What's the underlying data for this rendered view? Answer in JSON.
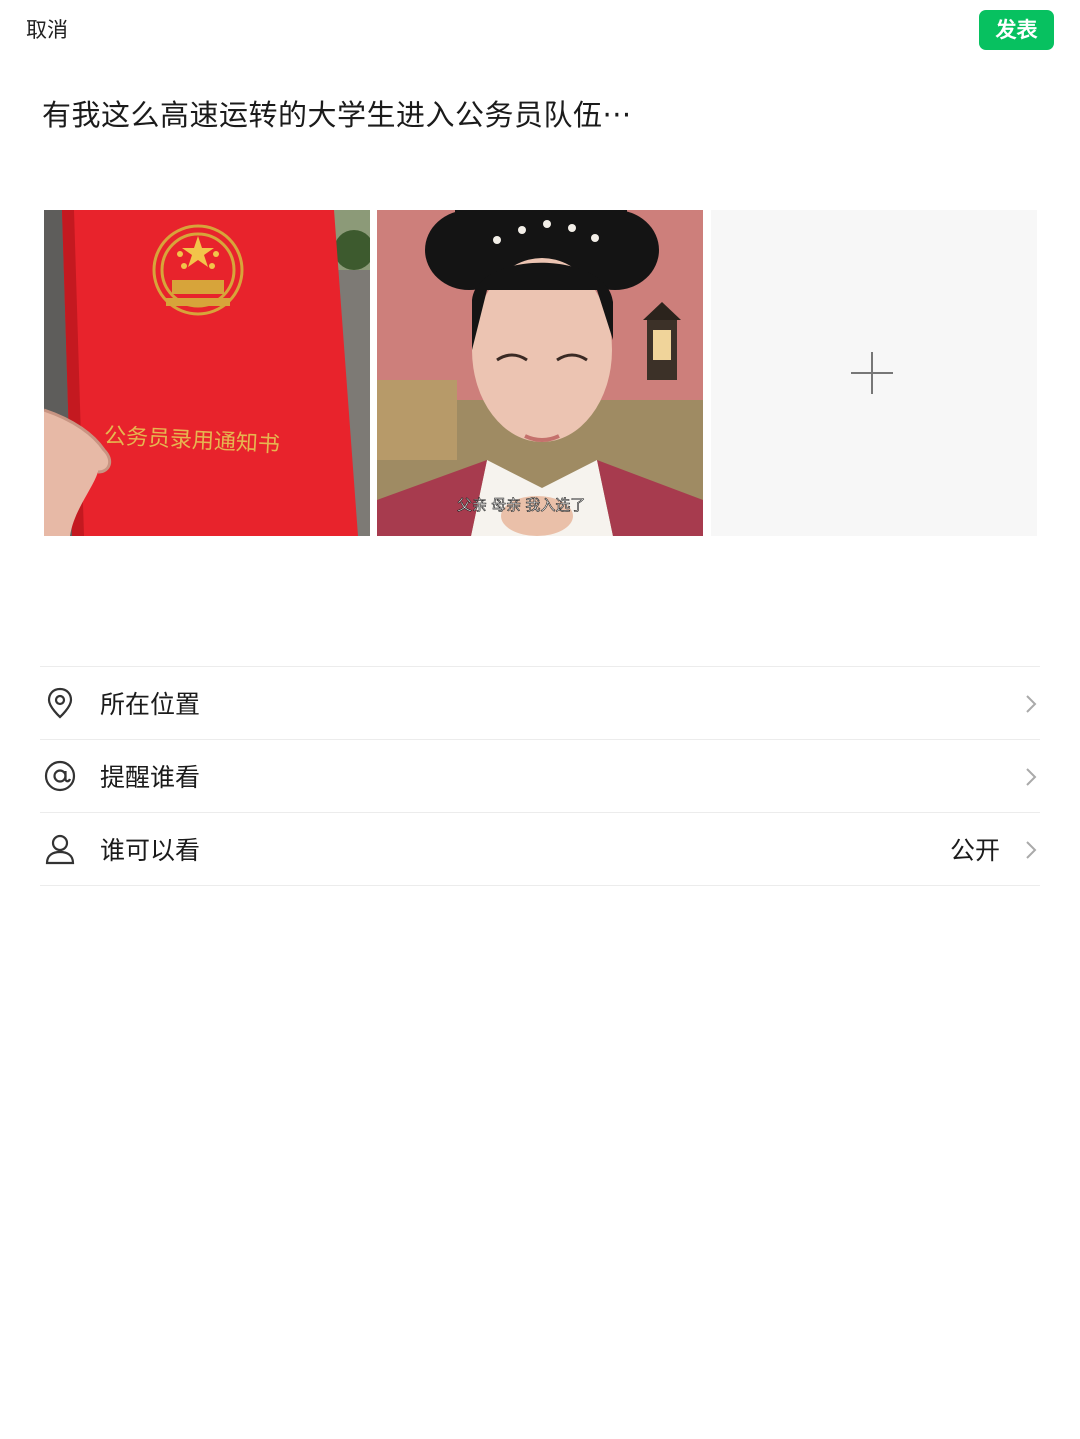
{
  "header": {
    "cancel_label": "取消",
    "publish_label": "发表",
    "accent_color": "#07c160"
  },
  "post": {
    "text": "有我这么高速运转的大学生进入公务员队伍···"
  },
  "photos": [
    {
      "description_icon": "certificate-photo",
      "caption_text": "公务员录用通知书"
    },
    {
      "description_icon": "drama-still-photo",
      "subtitle_text": "父亲    母亲    我入选了"
    }
  ],
  "add_photo": {
    "icon": "plus-icon"
  },
  "options": [
    {
      "icon": "location-pin-icon",
      "label": "所在位置",
      "value": ""
    },
    {
      "icon": "at-icon",
      "label": "提醒谁看",
      "value": ""
    },
    {
      "icon": "person-icon",
      "label": "谁可以看",
      "value": "公开"
    }
  ]
}
